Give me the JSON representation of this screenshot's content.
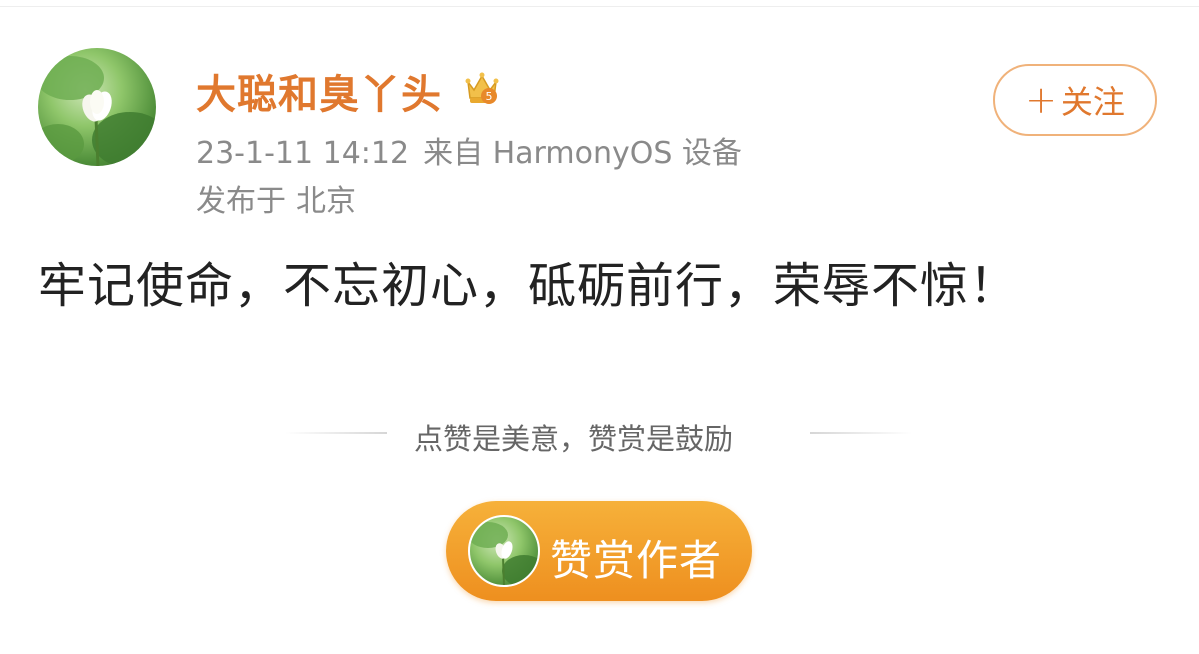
{
  "post": {
    "author": {
      "name": "大聪和臭丫头",
      "avatar_icon": "lotus-avatar",
      "badge_icon": "crown-vip-icon",
      "badge_level": "5"
    },
    "timestamp": "23-1-11 14:12",
    "source": "来自 HarmonyOS 设备",
    "location_prefix": "发布于",
    "location": "北京",
    "follow_button": {
      "plus": "+",
      "label": "关注"
    },
    "text": "牢记使命，不忘初心，砥砺前行，荣辱不惊！"
  },
  "reward": {
    "tip": "点赞是美意，赞赏是鼓励",
    "button_label": "赞赏作者"
  },
  "colors": {
    "accent": "#e0782e",
    "meta_gray": "#8a8a8a",
    "reward_orange": "#ee8f1f"
  }
}
